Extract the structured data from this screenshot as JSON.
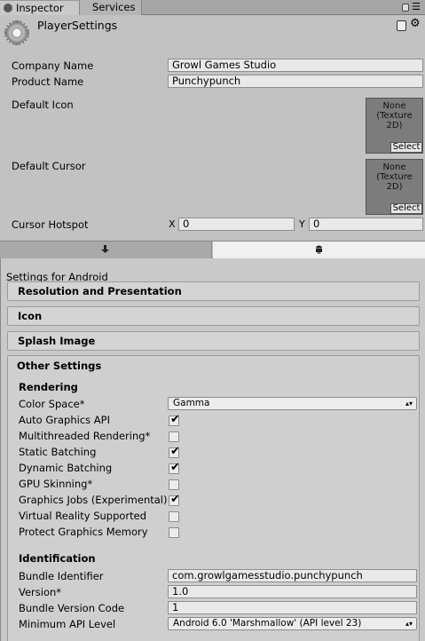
{
  "tabs": {
    "inspector": "Inspector",
    "services": "Services"
  },
  "header": {
    "title": "PlayerSettings"
  },
  "fields": {
    "company_label": "Company Name",
    "company_value": "Growl Games Studio",
    "product_label": "Product Name",
    "product_value": "Punchypunch",
    "default_icon_label": "Default Icon",
    "default_cursor_label": "Default Cursor",
    "texture_text_1": "None",
    "texture_text_2": "(Texture",
    "texture_text_3": "2D)",
    "select_label": "Select",
    "hotspot_label": "Cursor Hotspot",
    "hotspot_x_label": "X",
    "hotspot_x_value": "0",
    "hotspot_y_label": "Y",
    "hotspot_y_value": "0"
  },
  "platform": {
    "settings_for": "Settings for Android"
  },
  "sections": {
    "resolution": "Resolution and Presentation",
    "icon": "Icon",
    "splash": "Splash Image",
    "other": "Other Settings"
  },
  "rendering": {
    "heading": "Rendering",
    "color_space_label": "Color Space*",
    "color_space_value": "Gamma",
    "rows": [
      {
        "label": "Auto Graphics API",
        "checked": true
      },
      {
        "label": "Multithreaded Rendering*",
        "checked": false
      },
      {
        "label": "Static Batching",
        "checked": true
      },
      {
        "label": "Dynamic Batching",
        "checked": true
      },
      {
        "label": "GPU Skinning*",
        "checked": false
      },
      {
        "label": "Graphics Jobs (Experimental)",
        "checked": true
      },
      {
        "label": "Virtual Reality Supported",
        "checked": false
      },
      {
        "label": "Protect Graphics Memory",
        "checked": false
      }
    ]
  },
  "identification": {
    "heading": "Identification",
    "bundle_id_label": "Bundle Identifier",
    "bundle_id_value": "com.growlgamesstudio.punchypunch",
    "version_label": "Version*",
    "version_value": "1.0",
    "bundle_code_label": "Bundle Version Code",
    "bundle_code_value": "1",
    "min_api_label": "Minimum API Level",
    "min_api_value": "Android 6.0 'Marshmallow' (API level 23)"
  }
}
